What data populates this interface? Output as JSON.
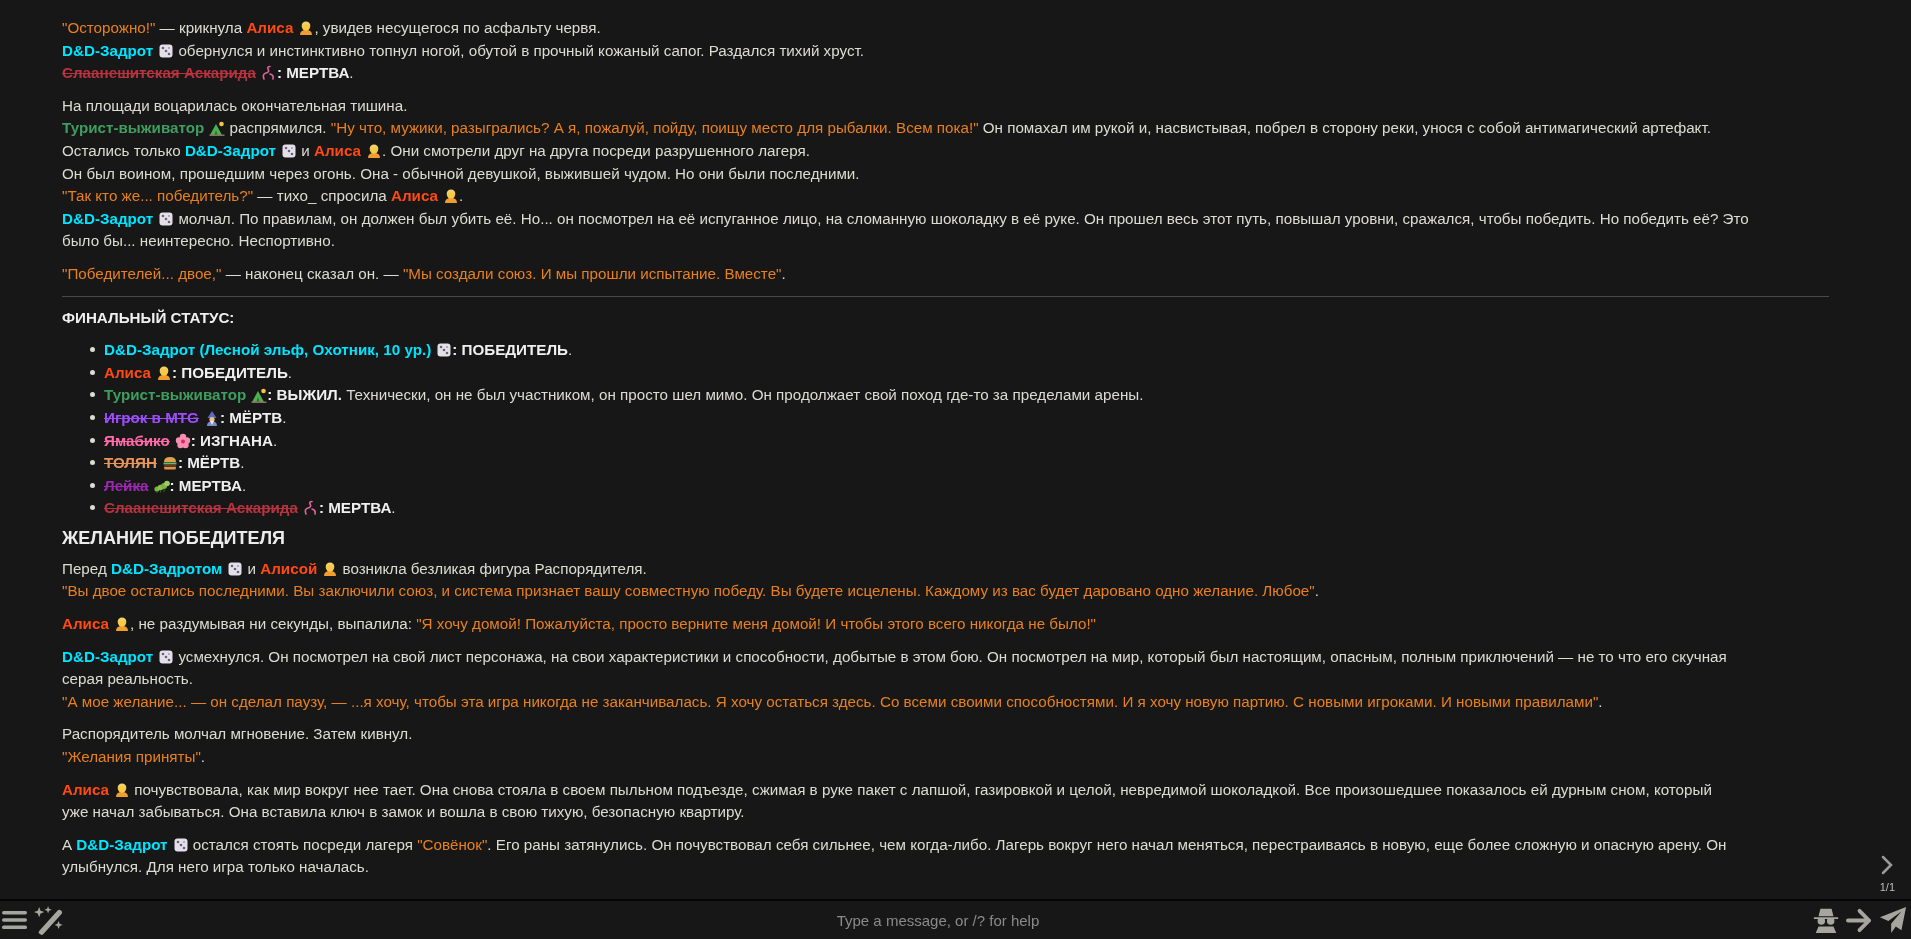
{
  "chat": {
    "blocks": [
      {
        "kind": "para",
        "lines": [
          [
            {
              "kind": "quote",
              "text": "\"Осторожно!\""
            },
            {
              "kind": "text",
              "text": " — крикнула "
            },
            {
              "kind": "name",
              "text": "Алиса",
              "color": "#ff4a14",
              "struck": false
            },
            {
              "kind": "girl"
            },
            {
              "kind": "text",
              "text": ", увидев несущегося по асфальту червя."
            }
          ],
          [
            {
              "kind": "name",
              "text": "D&D-Задрот",
              "color": "#00e5ff",
              "struck": false
            },
            {
              "kind": "dice"
            },
            {
              "kind": "text",
              "text": " обернулся и инстинктивно топнул ногой, обутой в прочный кожаный сапог. Раздался тихий хруст."
            }
          ],
          [
            {
              "kind": "name",
              "text": "Слаанешитская Аскарида",
              "color": "#b8323f",
              "struck": true
            },
            {
              "kind": "worm"
            },
            {
              "kind": "bold",
              "text": ": МЕРТВА"
            },
            {
              "kind": "text",
              "text": "."
            }
          ]
        ]
      },
      {
        "kind": "para",
        "lines": [
          [
            {
              "kind": "text",
              "text": "На площади воцарилась окончательная тишина."
            }
          ],
          [
            {
              "kind": "name",
              "text": "Турист-выживатор",
              "color": "#3f9d5f",
              "struck": false
            },
            {
              "kind": "tourist"
            },
            {
              "kind": "text",
              "text": " распрямился. "
            },
            {
              "kind": "quote",
              "text": "\"Ну что, мужики, разыгрались? А я, пожалуй, пойду, поищу место для рыбалки. Всем пока!\""
            },
            {
              "kind": "text",
              "text": " Он помахал им рукой и, насвистывая, побрел в сторону реки, унося с собой антимагический артефакт."
            }
          ],
          [
            {
              "kind": "text",
              "text": "Остались только "
            },
            {
              "kind": "name",
              "text": "D&D-Задрот",
              "color": "#00e5ff",
              "struck": false
            },
            {
              "kind": "dice"
            },
            {
              "kind": "text",
              "text": " и "
            },
            {
              "kind": "name",
              "text": "Алиса",
              "color": "#ff4a14",
              "struck": false
            },
            {
              "kind": "girl"
            },
            {
              "kind": "text",
              "text": ". Они смотрели друг на друга посреди разрушенного лагеря."
            }
          ],
          [
            {
              "kind": "text",
              "text": "Он был воином, прошедшим через огонь. Она - обычной девушкой, выжившей чудом. Но они были последними."
            }
          ],
          [
            {
              "kind": "quote",
              "text": "\"Так кто же... победитель?\""
            },
            {
              "kind": "text",
              "text": " — тихо_ спросила "
            },
            {
              "kind": "name",
              "text": "Алиса",
              "color": "#ff4a14",
              "struck": false
            },
            {
              "kind": "girl"
            },
            {
              "kind": "text",
              "text": "."
            }
          ],
          [
            {
              "kind": "name",
              "text": "D&D-Задрот",
              "color": "#00e5ff",
              "struck": false
            },
            {
              "kind": "dice"
            },
            {
              "kind": "text",
              "text": " молчал. По правилам, он должен был убить её. Но... он посмотрел на её испуганное лицо, на сломанную шоколадку в её руке. Он прошел весь этот путь, повышал уровни, сражался, чтобы победить. Но победить её? Это"
            }
          ],
          [
            {
              "kind": "text",
              "text": "было бы... неинтересно. Неспортивно."
            }
          ]
        ]
      },
      {
        "kind": "para",
        "lines": [
          [
            {
              "kind": "quote",
              "text": "\"Победителей... двое,\""
            },
            {
              "kind": "text",
              "text": " — наконец сказал он. — "
            },
            {
              "kind": "quote",
              "text": "\"Мы создали союз. И мы прошли испытание. Вместе\""
            },
            {
              "kind": "text",
              "text": "."
            }
          ]
        ]
      },
      {
        "kind": "rule"
      },
      {
        "kind": "para",
        "lines": [
          [
            {
              "kind": "bold",
              "text": "ФИНАЛЬНЫЙ СТАТУС:"
            }
          ]
        ]
      },
      {
        "kind": "list",
        "items": [
          [
            {
              "kind": "name",
              "text": "D&D-Задрот (Лесной эльф, Охотник, 10 ур.)",
              "color": "#00e5ff",
              "struck": false
            },
            {
              "kind": "dice"
            },
            {
              "kind": "bold",
              "text": ": ПОБЕДИТЕЛЬ"
            },
            {
              "kind": "text",
              "text": "."
            }
          ],
          [
            {
              "kind": "name",
              "text": "Алиса",
              "color": "#ff4a14",
              "struck": false
            },
            {
              "kind": "girl"
            },
            {
              "kind": "bold",
              "text": ": ПОБЕДИТЕЛЬ"
            },
            {
              "kind": "text",
              "text": "."
            }
          ],
          [
            {
              "kind": "name",
              "text": "Турист-выживатор",
              "color": "#3f9d5f",
              "struck": false
            },
            {
              "kind": "tourist"
            },
            {
              "kind": "bold",
              "text": ": ВЫЖИЛ."
            },
            {
              "kind": "text",
              "text": " Технически, он не был участником, он просто шел мимо. Он продолжает свой поход где-то за пределами арены."
            }
          ],
          [
            {
              "kind": "name",
              "text": "Игрок в MTG",
              "color": "#9d4dff",
              "struck": true
            },
            {
              "kind": "mage"
            },
            {
              "kind": "bold",
              "text": ": МЁРТВ"
            },
            {
              "kind": "text",
              "text": "."
            }
          ],
          [
            {
              "kind": "name",
              "text": "Ямабико",
              "color": "#ff6aa8",
              "struck": true
            },
            {
              "kind": "flower"
            },
            {
              "kind": "bold",
              "text": ": ИЗГНАНА"
            },
            {
              "kind": "text",
              "text": "."
            }
          ],
          [
            {
              "kind": "name",
              "text": "ТОЛЯН",
              "color": "#e8955c",
              "struck": true
            },
            {
              "kind": "burger"
            },
            {
              "kind": "bold",
              "text": ": МЁРТВ"
            },
            {
              "kind": "text",
              "text": "."
            }
          ],
          [
            {
              "kind": "name",
              "text": "Лейка",
              "color": "#9c27b0",
              "struck": true
            },
            {
              "kind": "bug"
            },
            {
              "kind": "bold",
              "text": ": МЕРТВА"
            },
            {
              "kind": "text",
              "text": "."
            }
          ],
          [
            {
              "kind": "name",
              "text": "Слаанешитская Аскарида",
              "color": "#b8323f",
              "struck": true
            },
            {
              "kind": "worm"
            },
            {
              "kind": "bold",
              "text": ": МЕРТВА"
            },
            {
              "kind": "text",
              "text": "."
            }
          ]
        ]
      },
      {
        "kind": "heading",
        "text": "ЖЕЛАНИЕ ПОБЕДИТЕЛЯ"
      },
      {
        "kind": "para",
        "lines": [
          [
            {
              "kind": "text",
              "text": "Перед "
            },
            {
              "kind": "name",
              "text": "D&D-Задротом",
              "color": "#00e5ff",
              "struck": false
            },
            {
              "kind": "dice"
            },
            {
              "kind": "text",
              "text": " и "
            },
            {
              "kind": "name",
              "text": "Алисой",
              "color": "#ff4a14",
              "struck": false
            },
            {
              "kind": "girl"
            },
            {
              "kind": "text",
              "text": " возникла безликая фигура Распорядителя."
            }
          ],
          [
            {
              "kind": "quote",
              "text": "\"Вы двое остались последними. Вы заключили союз, и система признает вашу совместную победу. Вы будете исцелены. Каждому из вас будет даровано одно желание. Любое\""
            },
            {
              "kind": "text",
              "text": "."
            }
          ]
        ]
      },
      {
        "kind": "para",
        "lines": [
          [
            {
              "kind": "name",
              "text": "Алиса",
              "color": "#ff4a14",
              "struck": false
            },
            {
              "kind": "girl"
            },
            {
              "kind": "text",
              "text": ", не раздумывая ни секунды, выпалила: "
            },
            {
              "kind": "quote",
              "text": "\"Я хочу домой! Пожалуйста, просто верните меня домой! И чтобы этого всего никогда не было!\""
            }
          ]
        ]
      },
      {
        "kind": "para",
        "lines": [
          [
            {
              "kind": "name",
              "text": "D&D-Задрот",
              "color": "#00e5ff",
              "struck": false
            },
            {
              "kind": "dice"
            },
            {
              "kind": "text",
              "text": " усмехнулся. Он посмотрел на свой лист персонажа, на свои характеристики и способности, добытые в этом бою. Он посмотрел на мир, который был настоящим, опасным, полным приключений — не то что его скучная"
            }
          ],
          [
            {
              "kind": "text",
              "text": "серая реальность."
            }
          ],
          [
            {
              "kind": "quote",
              "text": "\"А мое желание... — он сделал паузу, — ...я хочу, чтобы эта игра никогда не заканчивалась. Я хочу остаться здесь. Со всеми своими способностями. И я хочу новую партию. С новыми игроками. И новыми правилами\""
            },
            {
              "kind": "text",
              "text": "."
            }
          ]
        ]
      },
      {
        "kind": "para",
        "lines": [
          [
            {
              "kind": "text",
              "text": "Распорядитель молчал мгновение. Затем кивнул."
            }
          ],
          [
            {
              "kind": "quote",
              "text": "\"Желания приняты\""
            },
            {
              "kind": "text",
              "text": "."
            }
          ]
        ]
      },
      {
        "kind": "para",
        "lines": [
          [
            {
              "kind": "name",
              "text": "Алиса",
              "color": "#ff4a14",
              "struck": false
            },
            {
              "kind": "girl"
            },
            {
              "kind": "text",
              "text": " почувствовала, как мир вокруг нее тает. Она снова стояла в своем пыльном подъезде, сжимая в руке пакет с лапшой, газировкой и целой, невредимой шоколадкой. Все произошедшее показалось ей дурным сном, который"
            }
          ],
          [
            {
              "kind": "text",
              "text": "уже начал забываться. Она вставила ключ в замок и вошла в свою тихую, безопасную квартиру."
            }
          ]
        ]
      },
      {
        "kind": "para",
        "lines": [
          [
            {
              "kind": "text",
              "text": "А "
            },
            {
              "kind": "name",
              "text": "D&D-Задрот",
              "color": "#00e5ff",
              "struck": false
            },
            {
              "kind": "dice"
            },
            {
              "kind": "text",
              "text": " остался стоять посреди лагеря "
            },
            {
              "kind": "quote",
              "text": "\"Совёнок\""
            },
            {
              "kind": "text",
              "text": ". Его раны затянулись. Он почувствовал себя сильнее, чем когда-либо. Лагерь вокруг него начал меняться, перестраиваясь в новую, еще более сложную и опасную арену. Он"
            }
          ],
          [
            {
              "kind": "text",
              "text": "улыбнулся. Для него игра только началась."
            }
          ]
        ]
      }
    ]
  },
  "swipe": {
    "counter": "1/1"
  },
  "input": {
    "placeholder": "Type a message, or /? for help"
  }
}
